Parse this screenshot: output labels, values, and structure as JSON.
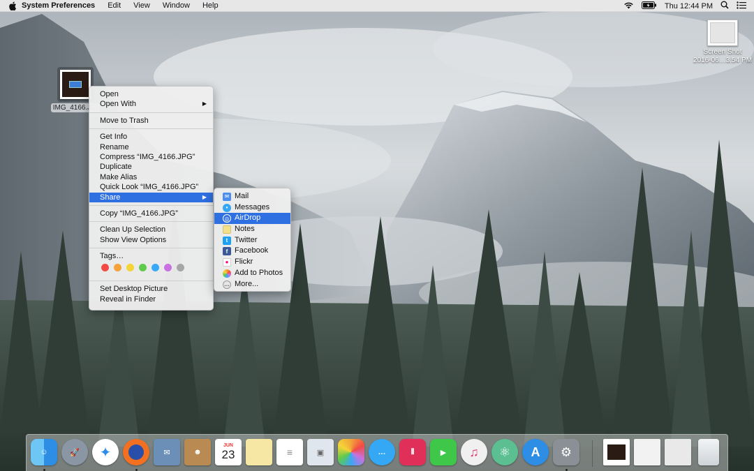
{
  "menubar": {
    "app_name": "System Preferences",
    "menus": [
      "Edit",
      "View",
      "Window",
      "Help"
    ],
    "clock": "Thu 12:44 PM",
    "icons": [
      "apple-icon",
      "wifi-icon",
      "battery-icon",
      "spotlight-icon",
      "notification-center-icon"
    ]
  },
  "desktop": {
    "screenshot_file": {
      "name_line1": "Screen Shot",
      "name_line2": "2016-06…3.54 PM"
    },
    "selected_file": {
      "name": "IMG_4166.J…"
    }
  },
  "context_menu": {
    "items": {
      "open": "Open",
      "open_with": "Open With",
      "move_to_trash": "Move to Trash",
      "get_info": "Get Info",
      "rename": "Rename",
      "compress": "Compress “IMG_4166.JPG”",
      "duplicate": "Duplicate",
      "make_alias": "Make Alias",
      "quick_look": "Quick Look “IMG_4166.JPG”",
      "share": "Share",
      "copy": "Copy “IMG_4166.JPG”",
      "clean_up": "Clean Up Selection",
      "show_view_options": "Show View Options",
      "tags": "Tags…",
      "set_desktop_picture": "Set Desktop Picture",
      "reveal_in_finder": "Reveal in Finder"
    },
    "tag_colors": [
      "#f24b45",
      "#f5a23a",
      "#f5d437",
      "#5fca4b",
      "#39a8f6",
      "#c971e0",
      "#a6a6a6"
    ]
  },
  "share_menu": {
    "items": [
      "Mail",
      "Messages",
      "AirDrop",
      "Notes",
      "Twitter",
      "Facebook",
      "Flickr",
      "Add to Photos",
      "More..."
    ],
    "highlighted": "AirDrop",
    "icon_colors": [
      "#4b8ef0",
      "#35a8f5",
      "#2e6fe1",
      "#f3e08a",
      "#1da1f2",
      "#3b5998",
      "#ffffff",
      "#f2a33a",
      "#e6e6e6"
    ]
  },
  "dock": {
    "apps": [
      "Finder",
      "Launchpad",
      "Safari",
      "Firefox",
      "Mail",
      "Contacts",
      "Calendar",
      "Notes",
      "Reminders",
      "Preview",
      "Photos",
      "Messages",
      "Klokki",
      "FaceTime",
      "iTunes",
      "Atom",
      "App Store",
      "System Preferences"
    ],
    "calendar": {
      "month": "JUN",
      "day": "23"
    },
    "right_items": [
      "Downloads stack",
      "Documents stack",
      "Screenshots stack",
      "Trash"
    ]
  }
}
